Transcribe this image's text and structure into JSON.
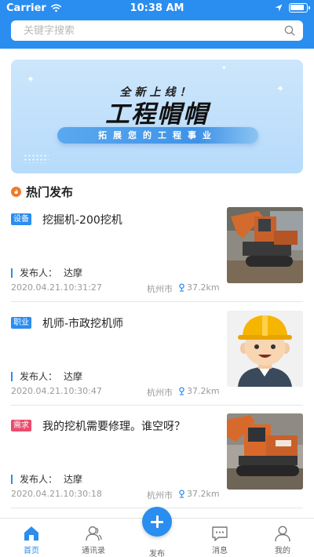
{
  "status_bar": {
    "carrier": "Carrier",
    "time": "10:38 AM"
  },
  "search": {
    "placeholder": "关键字搜索"
  },
  "banner": {
    "subtitle": "全新上线！",
    "title": "工程帽帽",
    "slogan": "拓展您的工程事业"
  },
  "section": {
    "title": "热门发布"
  },
  "posts": [
    {
      "tag": "设备",
      "tag_color": "#2a8df0",
      "title": "挖掘机-200挖机",
      "publisher_label": "发布人：",
      "publisher": "达摩",
      "date": "2020.04.21.10:31:27",
      "city": "杭州市",
      "distance": "37.2km",
      "image": "excavator-photo"
    },
    {
      "tag": "职业",
      "tag_color": "#2a8df0",
      "title": "机师-市政挖机师",
      "publisher_label": "发布人：",
      "publisher": "达摩",
      "date": "2020.04.21.10:30:47",
      "city": "杭州市",
      "distance": "37.2km",
      "image": "worker-avatar"
    },
    {
      "tag": "需求",
      "tag_color": "#e94b6d",
      "title": "我的挖机需要修理。谁空呀？",
      "publisher_label": "发布人：",
      "publisher": "达摩",
      "date": "2020.04.21.10:30:18",
      "city": "杭州市",
      "distance": "37.2km",
      "image": "excavator-photo"
    }
  ],
  "tabbar": {
    "home": "首页",
    "contacts": "通讯录",
    "publish": "发布",
    "messages": "消息",
    "mine": "我的"
  },
  "colors": {
    "primary": "#2a8df0",
    "demand_tag": "#e94b6d",
    "section_icon": "#f07a2a"
  }
}
